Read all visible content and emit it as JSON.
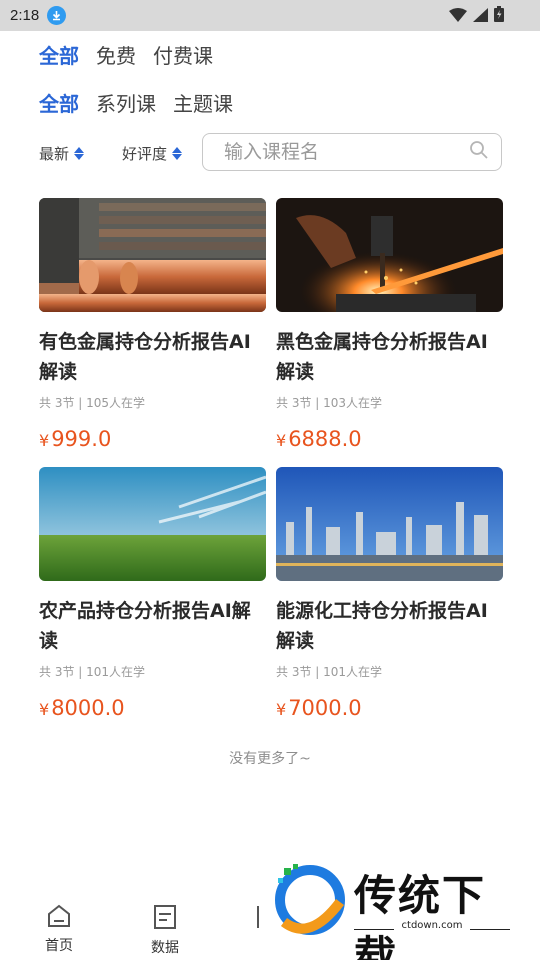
{
  "status_bar": {
    "time": "2:18"
  },
  "filters": {
    "price_tabs": [
      {
        "label": "全部",
        "active": true
      },
      {
        "label": "免费",
        "active": false
      },
      {
        "label": "付费课",
        "active": false
      }
    ],
    "type_tabs": [
      {
        "label": "全部",
        "active": true
      },
      {
        "label": "系列课",
        "active": false
      },
      {
        "label": "主题课",
        "active": false
      }
    ],
    "sort_latest": "最新",
    "sort_rating": "好评度",
    "search_placeholder": "输入课程名"
  },
  "courses": [
    {
      "title": "有色金属持仓分析报告AI解读",
      "meta": "共 3节 | 105人在学",
      "currency": "¥",
      "price": "999.0",
      "image": "copper-rods"
    },
    {
      "title": "黑色金属持仓分析报告AI解读",
      "meta": "共 3节 | 103人在学",
      "currency": "¥",
      "price": "6888.0",
      "image": "blacksmith-forge"
    },
    {
      "title": "农产品持仓分析报告AI解读",
      "meta": "共 3节 | 101人在学",
      "currency": "¥",
      "price": "8000.0",
      "image": "green-field"
    },
    {
      "title": "能源化工持仓分析报告AI解读",
      "meta": "共 3节 | 101人在学",
      "currency": "¥",
      "price": "7000.0",
      "image": "chemical-plant"
    }
  ],
  "list_end_text": "没有更多了~",
  "bottom_nav": [
    {
      "label": "首页",
      "icon": "home-icon"
    },
    {
      "label": "数据",
      "icon": "document-icon"
    }
  ],
  "watermark": {
    "title": "传统下载",
    "url": "ctdown.com"
  },
  "colors": {
    "accent": "#2b67d6",
    "price": "#e8541e",
    "status_bar": "#d9d9d9"
  }
}
